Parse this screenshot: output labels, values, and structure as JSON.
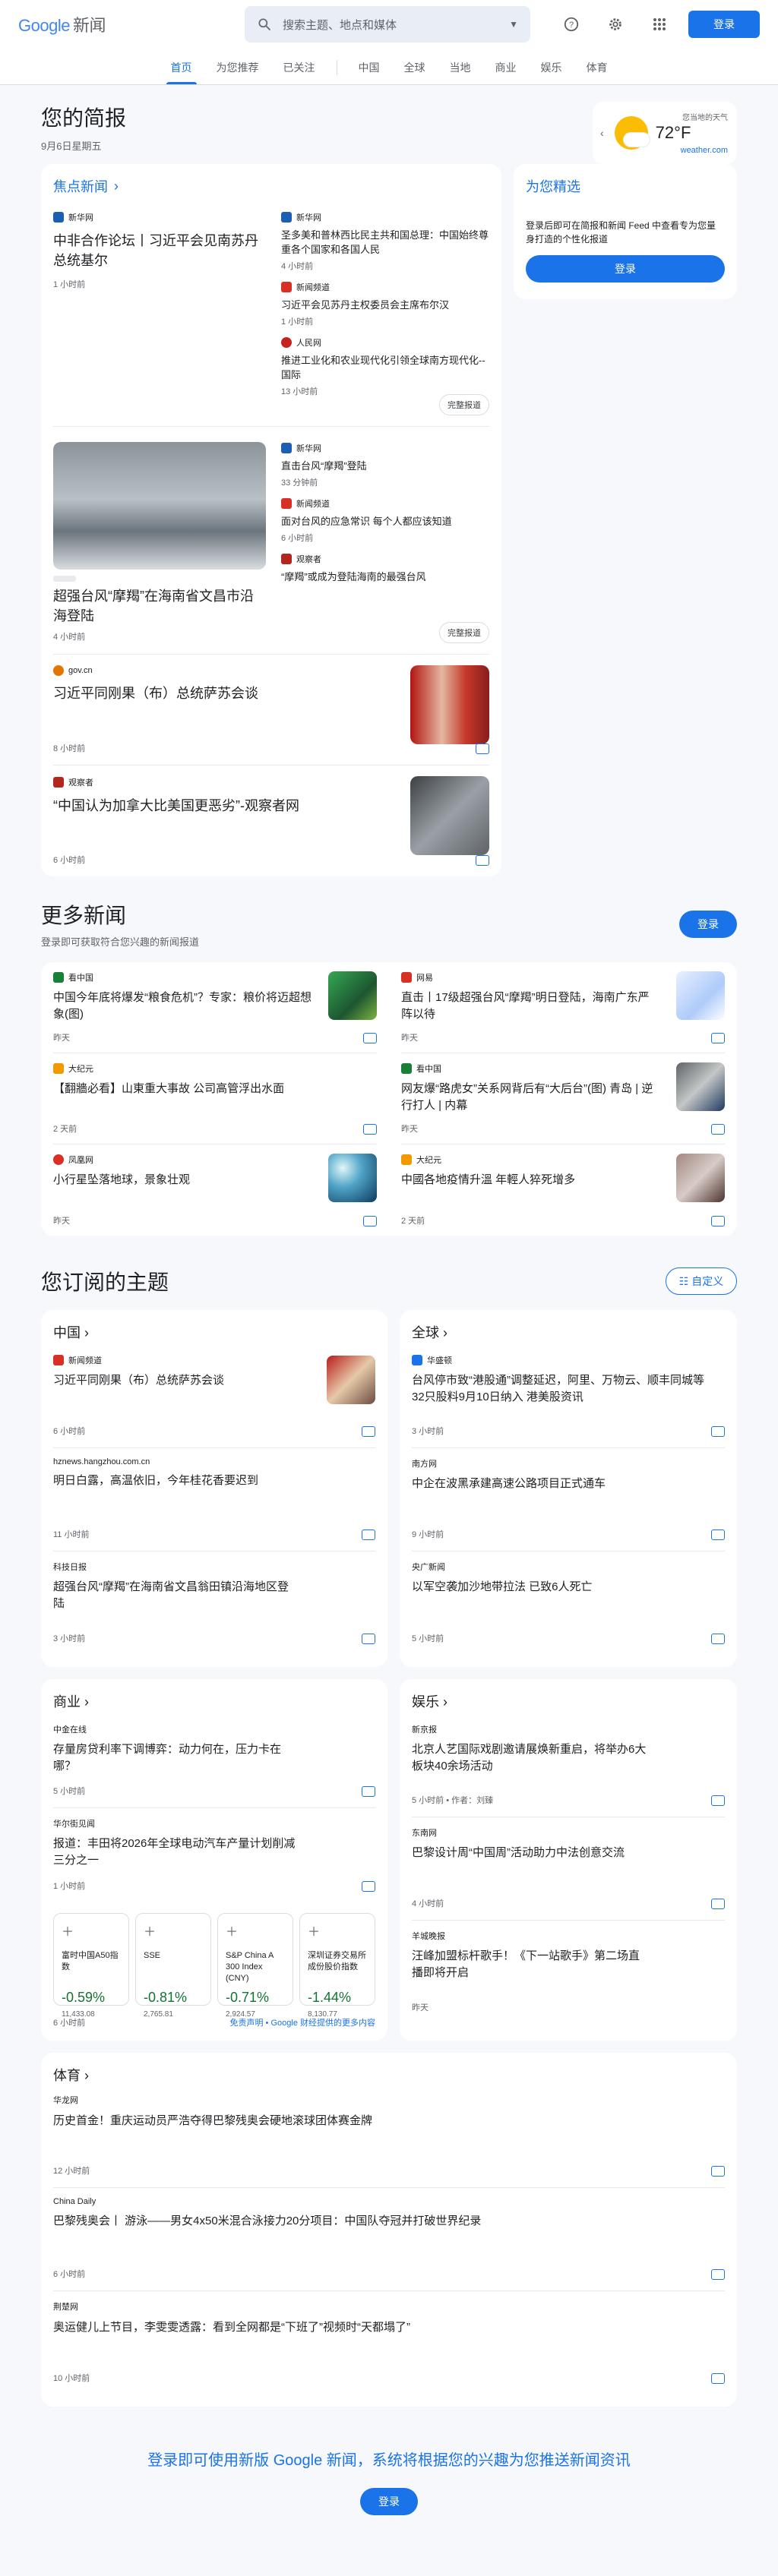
{
  "header": {
    "logo_google": "Google",
    "logo_news": "新闻",
    "search_placeholder": "搜索主题、地点和媒体",
    "login": "登录"
  },
  "nav": [
    "首页",
    "为您推荐",
    "已关注",
    "中国",
    "全球",
    "当地",
    "商业",
    "娱乐",
    "体育"
  ],
  "brief": {
    "title": "您的简报",
    "date": "9月6日星期五"
  },
  "weather": {
    "label": "您当地的天气",
    "temp": "72°F",
    "source": "weather.com"
  },
  "top": {
    "title": "焦点新闻",
    "groups": [
      {
        "lead": {
          "source": "新华网",
          "title": "中非合作论坛丨习近平会见南苏丹总统基尔",
          "time": "1 小时前"
        },
        "side": [
          {
            "source": "新华网",
            "title": "圣多美和普林西比民主共和国总理：中国始终尊重各个国家和各国人民",
            "time": "4 小时前"
          },
          {
            "source": "新闻频道",
            "title": "习近平会见苏丹主权委员会主席布尔汉",
            "time": "1 小时前"
          },
          {
            "source": "人民网",
            "title": "推进工业化和农业现代化引领全球南方现代化--国际",
            "time": "13 小时前"
          }
        ],
        "coverage": "完整报道"
      },
      {
        "lead": {
          "source": "",
          "title": "超强台风“摩羯”在海南省文昌市沿海登陆",
          "time": "4 小时前"
        },
        "side": [
          {
            "source": "新华网",
            "title": "直击台风“摩羯”登陆",
            "time": "33 分钟前"
          },
          {
            "source": "新闻频道",
            "title": "面对台风的应急常识 每个人都应该知道",
            "time": "6 小时前"
          },
          {
            "source": "观察者",
            "title": "“摩羯”或成为登陆海南的最强台风",
            "time": ""
          }
        ],
        "coverage": "完整报道"
      }
    ],
    "rows": [
      {
        "source": "gov.cn",
        "title": "习近平同刚果（布）总统萨苏会谈",
        "time": "8 小时前"
      },
      {
        "source": "观察者",
        "title": "“中国认为加拿大比美国更恶劣”-观察者网",
        "time": "6 小时前"
      }
    ]
  },
  "rec": {
    "title": "为您精选",
    "text": "登录后即可在简报和新闻 Feed 中查看专为您量身打造的个性化报道",
    "btn": "登录"
  },
  "more": {
    "title": "更多新闻",
    "sub": "登录即可获取符合您兴趣的新闻报道",
    "btn": "登录",
    "items": [
      {
        "source": "看中国",
        "title": "中国今年底将爆发“粮食危机”？专家：粮价将迈超想象(图)",
        "time": "昨天"
      },
      {
        "source": "网易",
        "title": "直击丨17级超强台风“摩羯”明日登陆，海南广东严阵以待",
        "time": "昨天"
      },
      {
        "source": "大纪元",
        "title": "【翻牆必看】山東重大事故 公司高管浮出水面",
        "time": "2 天前"
      },
      {
        "source": "看中国",
        "title": "网友爆“路虎女”关系网背后有“大后台”(图) 青岛 | 逆行打人 | 内幕",
        "time": "昨天"
      },
      {
        "source": "凤凰网",
        "title": "小行星坠落地球，景象壮观",
        "time": "昨天"
      },
      {
        "source": "大纪元",
        "title": "中國各地疫情升溫 年輕人猝死增多",
        "time": "2 天前"
      }
    ]
  },
  "topics": {
    "title": "您订阅的主题",
    "customize": "自定义",
    "cn": {
      "name": "中国",
      "items": [
        {
          "source": "新闻频道",
          "title": "习近平同刚果（布）总统萨苏会谈",
          "time": "6 小时前"
        },
        {
          "source": "hznews.hangzhou.com.cn",
          "title": "明日白露，高温依旧，今年桂花香要迟到",
          "time": "11 小时前"
        },
        {
          "source": "科技日报",
          "title": "超强台风“摩羯”在海南省文昌翁田镇沿海地区登陆",
          "time": "3 小时前"
        }
      ]
    },
    "world": {
      "name": "全球",
      "items": [
        {
          "source": "华盛顿",
          "title": "台风停市致“港股通”调整延迟，阿里、万物云、顺丰同城等32只股料9月10日纳入 港美股资讯",
          "time": "3 小时前"
        },
        {
          "source": "南方网",
          "title": "中企在波黑承建高速公路项目正式通车",
          "time": "9 小时前"
        },
        {
          "source": "央广新闻",
          "title": "以军空袭加沙地带拉法 已致6人死亡",
          "time": "5 小时前"
        }
      ]
    },
    "biz": {
      "name": "商业",
      "items": [
        {
          "source": "中金在线",
          "title": "存量房贷利率下调博弈：动力何在，压力卡在哪？",
          "time": "5 小时前"
        },
        {
          "source": "华尔街见闻",
          "title": "报道：丰田将2026年全球电动汽车产量计划削减三分之一",
          "time": "1 小时前"
        }
      ],
      "stocks": [
        {
          "name": "富时中国A50指数",
          "pct": "-0.59%",
          "val": "11,433.08"
        },
        {
          "name": "SSE",
          "pct": "-0.81%",
          "val": "2,765.81"
        },
        {
          "name": "S&P China A 300 Index (CNY)",
          "pct": "-0.71%",
          "val": "2,924.57"
        },
        {
          "name": "深圳证券交易所成份股价指数",
          "pct": "-1.44%",
          "val": "8,130.77"
        }
      ],
      "footer_time": "6 小时前",
      "disclaimer": "免责声明 • Google 财经提供的更多内容"
    },
    "ent": {
      "name": "娱乐",
      "items": [
        {
          "source": "新京报",
          "title": "北京人艺国际戏剧邀请展焕新重启，将举办6大板块40余场活动",
          "time": "5 小时前 • 作者：刘臻"
        },
        {
          "source": "东南网",
          "title": "巴黎设计周“中国周”活动助力中法创意交流",
          "time": "4 小时前"
        },
        {
          "source": "羊城晚报",
          "title": "汪峰加盟标杆歌手！《下一站歌手》第二场直播即将开启",
          "time": "昨天"
        }
      ]
    },
    "sports": {
      "name": "体育",
      "items": [
        {
          "source": "华龙网",
          "title": "历史首金！重庆运动员严浩夺得巴黎残奥会硬地滚球团体赛金牌",
          "time": "12 小时前"
        },
        {
          "source": "China Daily",
          "title": "巴黎残奥会丨 游泳——男女4x50米混合泳接力20分项目：中国队夺冠并打破世界纪录",
          "time": "6 小时前"
        },
        {
          "source": "荆楚网",
          "title": "奥运健儿上节目，李雯雯透露：看到全网都是“下班了”视频时“天都塌了”",
          "time": "10 小时前"
        }
      ]
    }
  },
  "footer": {
    "text": "登录即可使用新版 Google 新闻，系统将根据您的兴趣为您推送新闻资讯",
    "btn": "登录"
  }
}
